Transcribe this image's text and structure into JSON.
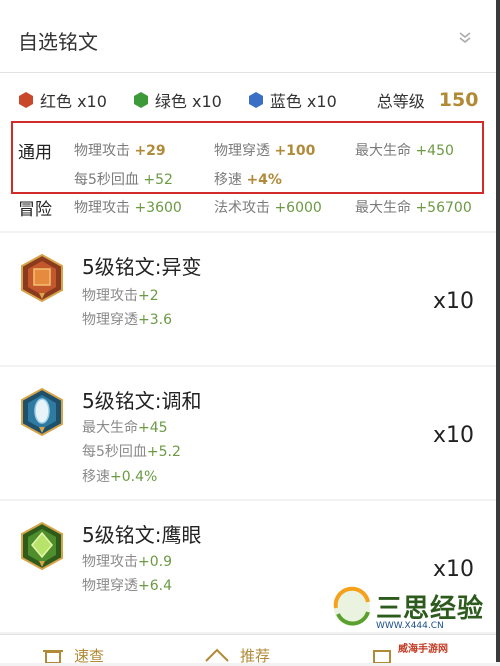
{
  "header": {
    "title": "自选铭文",
    "collapse_icon": "chevron-double-down-icon"
  },
  "colors": [
    {
      "label": "红色 x10",
      "color": "#c9472b",
      "icon": "hexagon-icon"
    },
    {
      "label": "绿色 x10",
      "color": "#3d9a3a",
      "icon": "hexagon-icon"
    },
    {
      "label": "蓝色 x10",
      "color": "#3a6fc8",
      "icon": "hexagon-icon"
    }
  ],
  "level": {
    "label": "总等级",
    "value": "150"
  },
  "general": {
    "label": "通用",
    "stats": [
      {
        "name": "物理攻击",
        "value": "+29"
      },
      {
        "name": "物理穿透",
        "value": "+100"
      },
      {
        "name": "最大生命",
        "value": "+450"
      },
      {
        "name": "每5秒回血",
        "value": "+52"
      },
      {
        "name": "移速",
        "value": "+4%"
      }
    ]
  },
  "adventure": {
    "label": "冒险",
    "stats": [
      {
        "name": "物理攻击",
        "value": "+3600"
      },
      {
        "name": "法术攻击",
        "value": "+6000"
      },
      {
        "name": "最大生命",
        "value": "+56700"
      }
    ]
  },
  "runes": [
    {
      "name": "5级铭文:异变",
      "icon": "red-rune-icon",
      "count": "x10",
      "attrs": [
        {
          "name": "物理攻击",
          "value": "+2"
        },
        {
          "name": "物理穿透",
          "value": "+3.6"
        }
      ]
    },
    {
      "name": "5级铭文:调和",
      "icon": "blue-rune-icon",
      "count": "x10",
      "attrs": [
        {
          "name": "最大生命",
          "value": "+45"
        },
        {
          "name": "每5秒回血",
          "value": "+5.2"
        },
        {
          "name": "移速",
          "value": "+0.4%"
        }
      ]
    },
    {
      "name": "5级铭文:鹰眼",
      "icon": "green-rune-icon",
      "count": "x10",
      "attrs": [
        {
          "name": "物理攻击",
          "value": "+0.9"
        },
        {
          "name": "物理穿透",
          "value": "+6.4"
        }
      ]
    }
  ],
  "bottom_bar": {
    "tabs": [
      {
        "label": "速查"
      },
      {
        "label": "推荐"
      }
    ]
  },
  "watermark": {
    "brand": "三思经验",
    "url": "WWW.X444.CN",
    "site": "威海手游网"
  }
}
